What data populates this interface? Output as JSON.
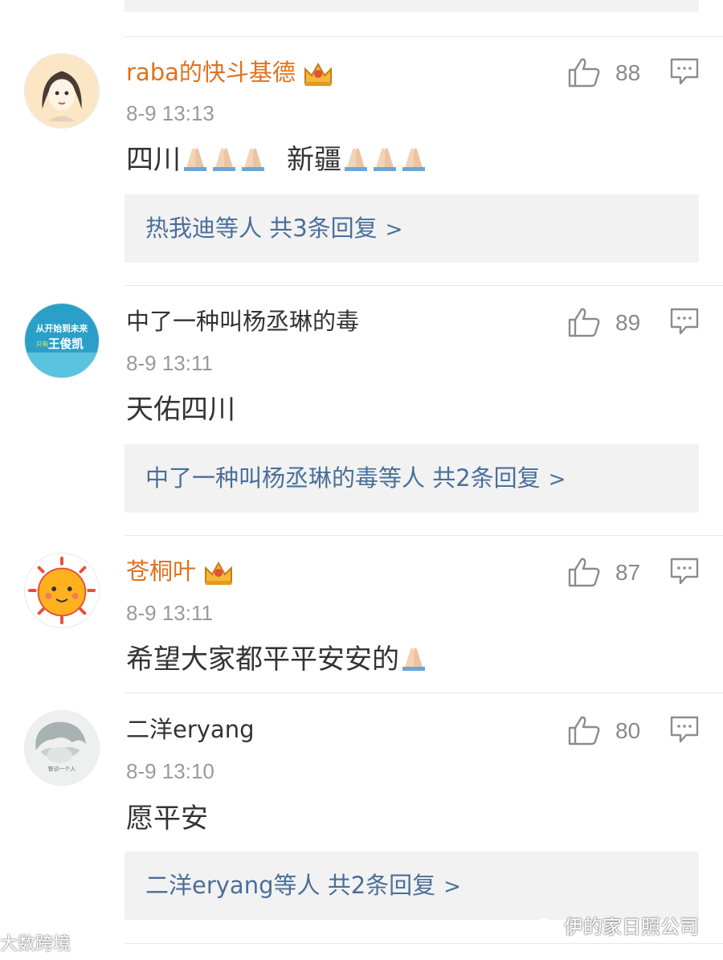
{
  "comments": [
    {
      "username": "raba的快斗基德",
      "vip": true,
      "timestamp": "8-9 13:13",
      "content_parts": [
        "四川",
        "新疆"
      ],
      "likes": "88",
      "replies_summary": "热我迪等人  共3条回复"
    },
    {
      "username": "中了一种叫杨丞琳的毒",
      "vip": false,
      "timestamp": "8-9 13:11",
      "content": "天佑四川",
      "likes": "89",
      "replies_summary": "中了一种叫杨丞琳的毒等人  共2条回复"
    },
    {
      "username": "苍桐叶",
      "vip": true,
      "timestamp": "8-9 13:11",
      "content": "希望大家都平平安安的",
      "likes": "87"
    },
    {
      "username": "二洋eryang",
      "vip": false,
      "timestamp": "8-9 13:10",
      "content": "愿平安",
      "likes": "80",
      "replies_summary": "二洋eryang等人  共2条回复"
    }
  ],
  "avatars": {
    "c2_text_line1": "从开始到未来",
    "c2_text_line2": "只有",
    "c2_text_line3": "王俊凯",
    "c4_text": "智识一个人"
  },
  "icons": {
    "like": "thumbs-up-icon",
    "reply": "comment-icon",
    "vip": "crown-icon",
    "emoji": "folded-hands-icon"
  },
  "colors": {
    "vip_name": "#e0711f",
    "link_blue": "#4a6f9a",
    "meta_gray": "#9a9a9a",
    "reply_bg": "#f2f2f2"
  },
  "watermarks": {
    "left": "大数跨境",
    "right": "伊的家日照公司"
  }
}
